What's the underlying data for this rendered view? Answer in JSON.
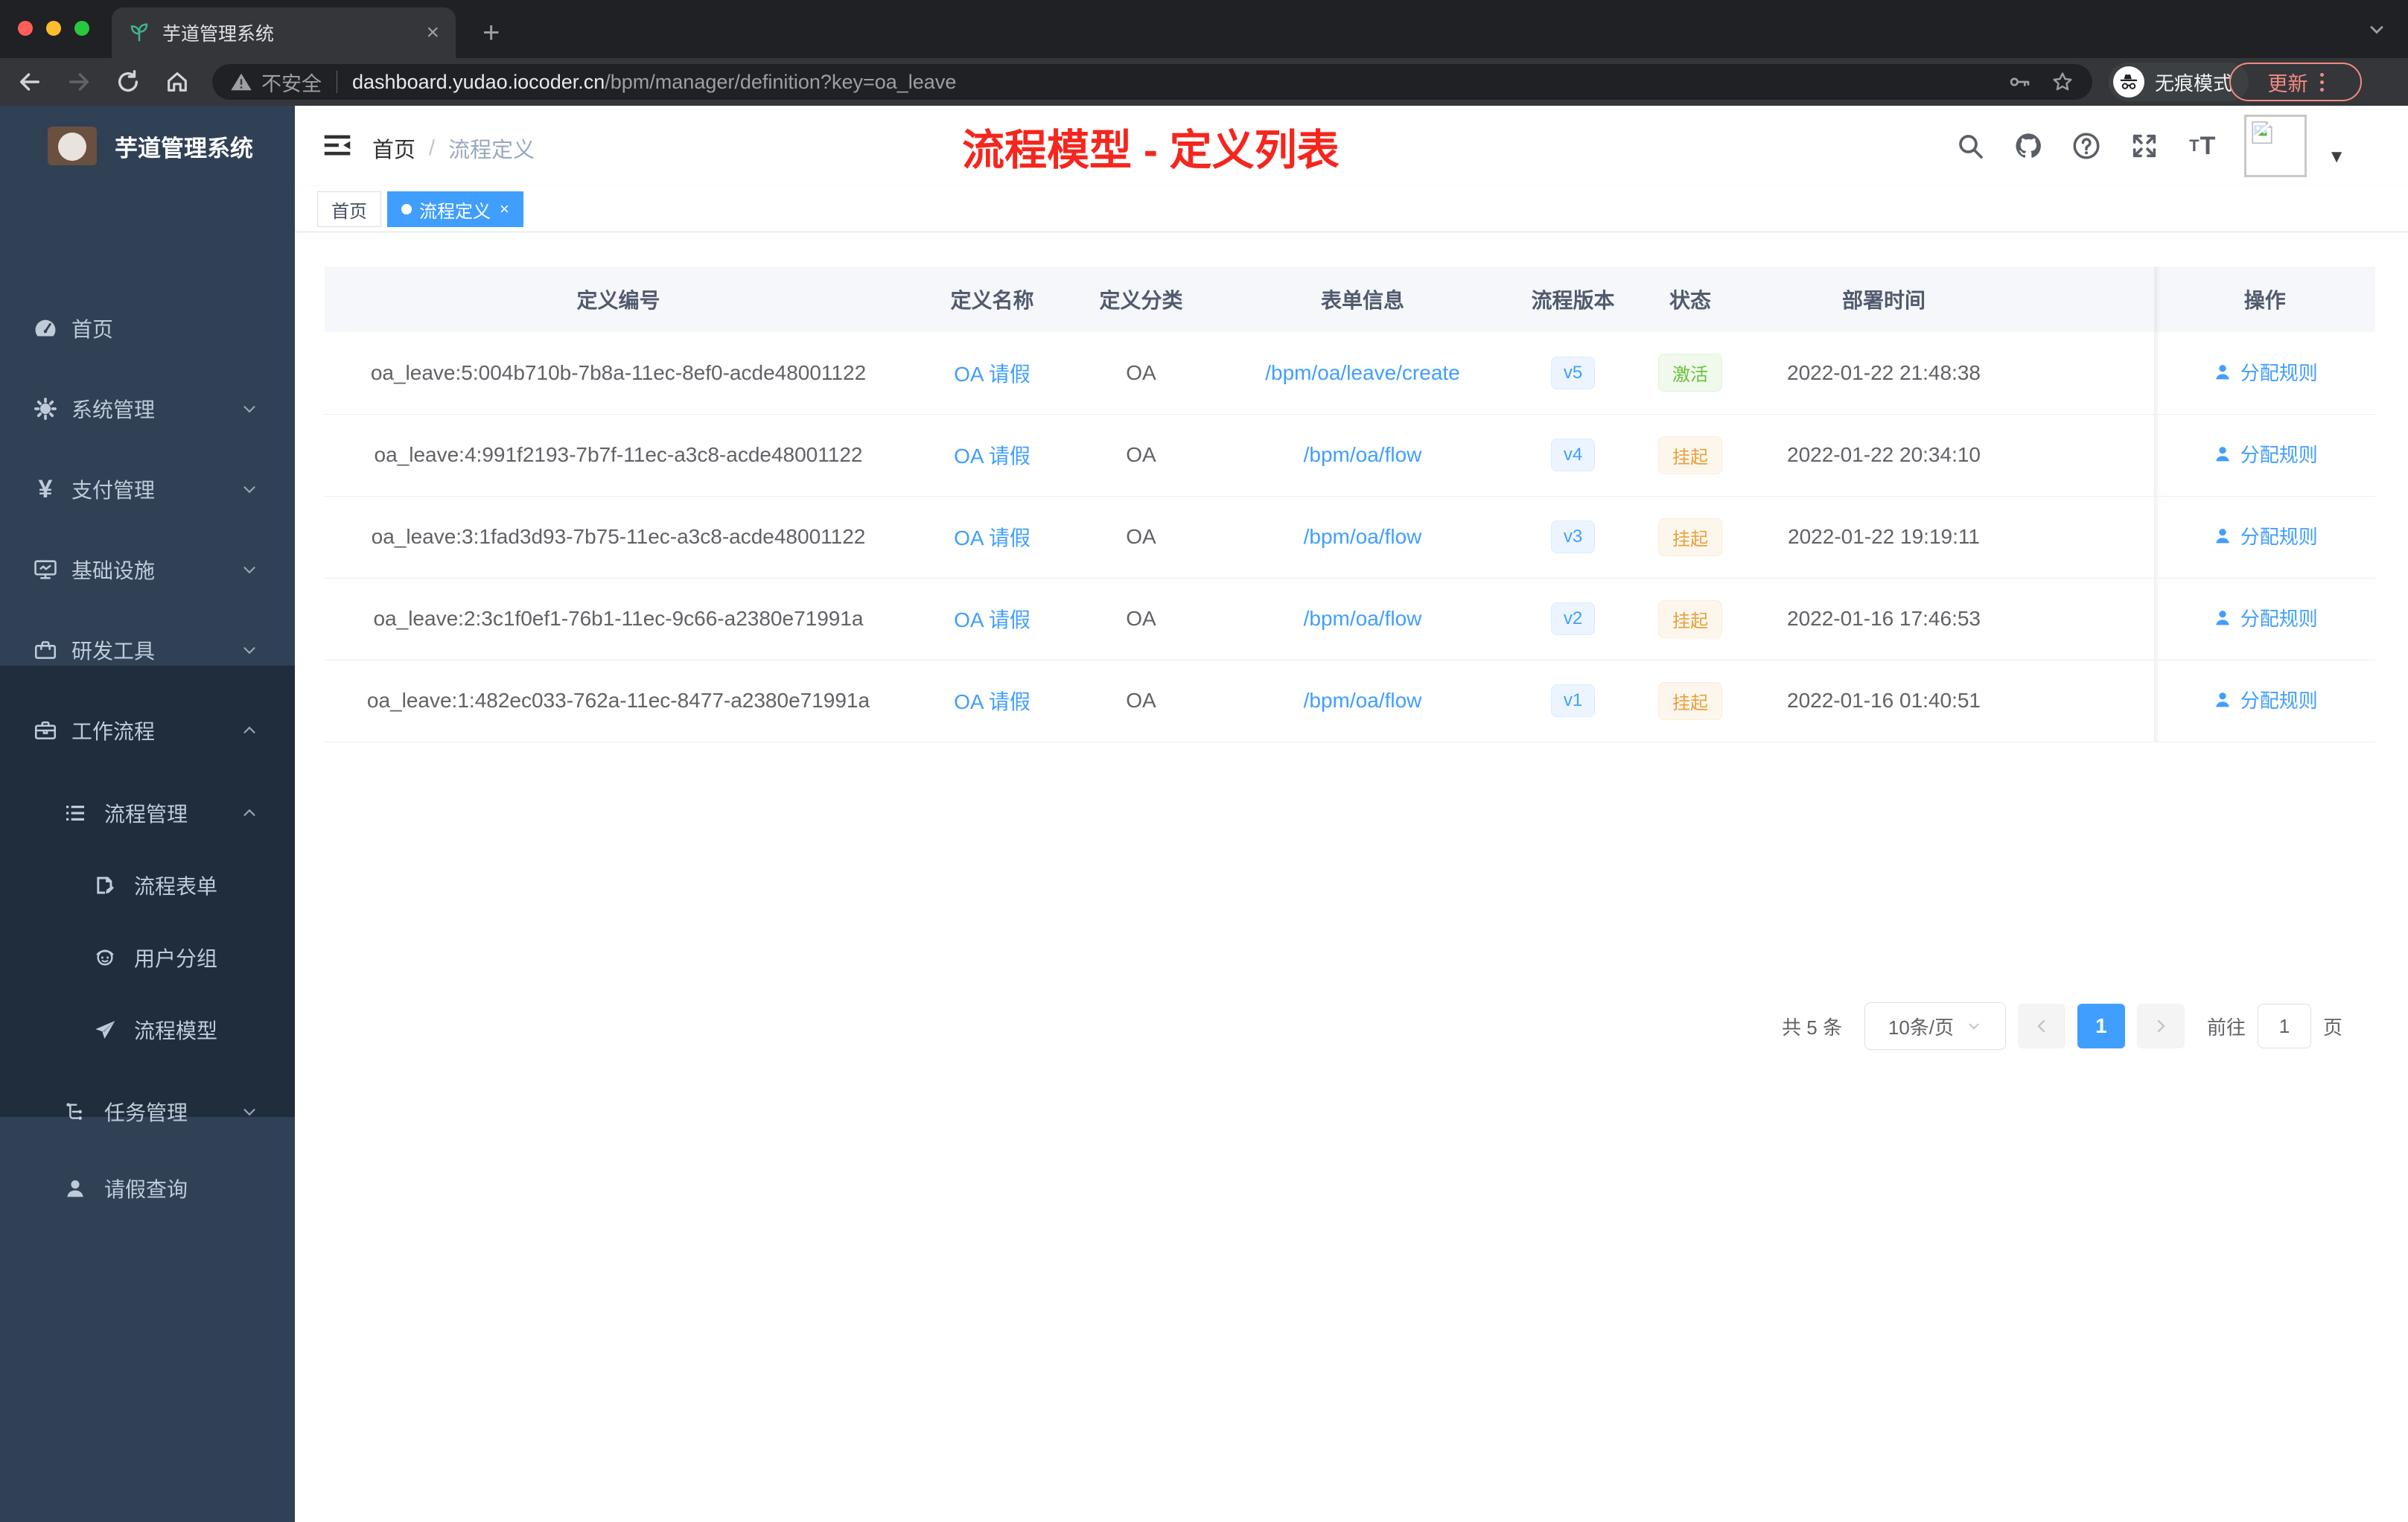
{
  "colors": {
    "accent_blue": "#409eff",
    "status_active_green": "#67c23a",
    "status_suspend_orange": "#e6a23c",
    "annotation_red": "#f5261d",
    "sidebar_bg": "#304156",
    "submenu_bg": "#1f2d3d",
    "update_pill_red": "#f28b82"
  },
  "browser": {
    "tab_title": "芋道管理系统",
    "security_label": "不安全",
    "url_host": "dashboard.yudao.iocoder.cn",
    "url_path": "/bpm/manager/definition?key=oa_leave",
    "incognito_label": "无痕模式",
    "update_label": "更新"
  },
  "sidebar": {
    "app_title": "芋道管理系统",
    "items": [
      {
        "label": "首页",
        "icon": "dashboard-icon"
      },
      {
        "label": "系统管理",
        "icon": "gear-icon",
        "arrow": "down"
      },
      {
        "label": "支付管理",
        "icon": "yen-icon",
        "arrow": "down"
      },
      {
        "label": "基础设施",
        "icon": "monitor-icon",
        "arrow": "down"
      },
      {
        "label": "研发工具",
        "icon": "toolbox-icon",
        "arrow": "down"
      },
      {
        "label": "工作流程",
        "icon": "suitcase-icon",
        "arrow": "up"
      },
      {
        "label": "流程管理",
        "icon": "list-icon",
        "arrow": "up"
      },
      {
        "label": "流程表单",
        "icon": "form-icon"
      },
      {
        "label": "用户分组",
        "icon": "users-icon"
      },
      {
        "label": "流程模型",
        "icon": "send-icon"
      },
      {
        "label": "任务管理",
        "icon": "tree-icon",
        "arrow": "down"
      },
      {
        "label": "请假查询",
        "icon": "user-icon"
      }
    ]
  },
  "navbar": {
    "breadcrumb_home": "首页",
    "breadcrumb_sep": "/",
    "breadcrumb_current": "流程定义"
  },
  "annotation": {
    "text": "流程模型 - 定义列表"
  },
  "tags": {
    "home": "首页",
    "active": "流程定义",
    "close": "×"
  },
  "table": {
    "columns": [
      "定义编号",
      "定义名称",
      "定义分类",
      "表单信息",
      "流程版本",
      "状态",
      "部署时间",
      "操作"
    ],
    "rows": [
      {
        "id": "oa_leave:5:004b710b-7b8a-11ec-8ef0-acde48001122",
        "name": "OA 请假",
        "category": "OA",
        "form": "/bpm/oa/leave/create",
        "version": "v5",
        "status": "激活",
        "status_type": "active",
        "time": "2022-01-22 21:48:38",
        "action": "分配规则"
      },
      {
        "id": "oa_leave:4:991f2193-7b7f-11ec-a3c8-acde48001122",
        "name": "OA 请假",
        "category": "OA",
        "form": "/bpm/oa/flow",
        "version": "v4",
        "status": "挂起",
        "status_type": "suspended",
        "time": "2022-01-22 20:34:10",
        "action": "分配规则"
      },
      {
        "id": "oa_leave:3:1fad3d93-7b75-11ec-a3c8-acde48001122",
        "name": "OA 请假",
        "category": "OA",
        "form": "/bpm/oa/flow",
        "version": "v3",
        "status": "挂起",
        "status_type": "suspended",
        "time": "2022-01-22 19:19:11",
        "action": "分配规则"
      },
      {
        "id": "oa_leave:2:3c1f0ef1-76b1-11ec-9c66-a2380e71991a",
        "name": "OA 请假",
        "category": "OA",
        "form": "/bpm/oa/flow",
        "version": "v2",
        "status": "挂起",
        "status_type": "suspended",
        "time": "2022-01-16 17:46:53",
        "action": "分配规则"
      },
      {
        "id": "oa_leave:1:482ec033-762a-11ec-8477-a2380e71991a",
        "name": "OA 请假",
        "category": "OA",
        "form": "/bpm/oa/flow",
        "version": "v1",
        "status": "挂起",
        "status_type": "suspended",
        "time": "2022-01-16 01:40:51",
        "action": "分配规则"
      }
    ]
  },
  "pagination": {
    "total": "共 5 条",
    "page_size": "10条/页",
    "page": "1",
    "goto_label": "前往",
    "goto_value": "1",
    "page_suffix": "页"
  }
}
